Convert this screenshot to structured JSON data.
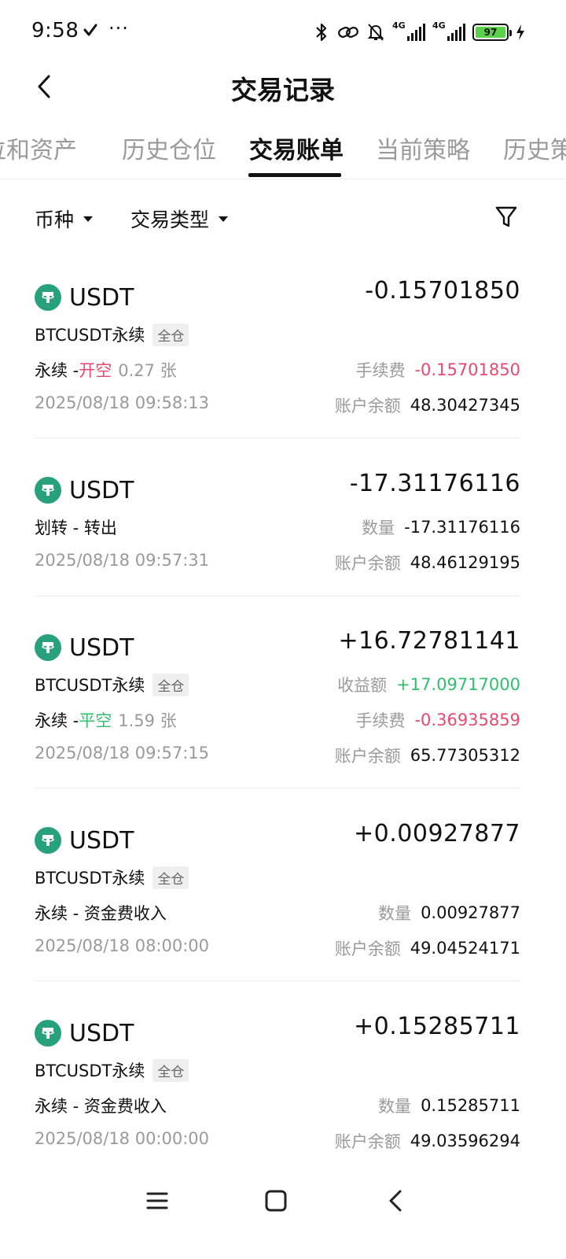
{
  "status_bar": {
    "time": "9:58",
    "dots": "···",
    "signal1_label": "4G",
    "signal2_label": "4G",
    "battery": "97"
  },
  "header": {
    "title": "交易记录"
  },
  "tabs": [
    {
      "label": "仓位和资产"
    },
    {
      "label": "历史仓位"
    },
    {
      "label": "交易账单"
    },
    {
      "label": "当前策略"
    },
    {
      "label": "历史策略"
    }
  ],
  "filters": {
    "coin": "币种",
    "type": "交易类型"
  },
  "colors": {
    "accent_green": "#2fbf6f",
    "negative_red": "#e8496f",
    "tether_green": "#26a17b",
    "battery_green": "#5ad14b"
  },
  "records": [
    {
      "coin": "USDT",
      "amount": "-0.15701850",
      "contract": "BTCUSDT永续",
      "margin": "全仓",
      "type_prefix": "永续 - ",
      "action": "开空",
      "size": "0.27 张",
      "fee_label": "手续费",
      "fee": "-0.15701850",
      "date": "2025/08/18 09:58:13",
      "balance_label": "账户余额",
      "balance": "48.30427345"
    },
    {
      "coin": "USDT",
      "amount": "-17.31176116",
      "type": "划转 - 转出",
      "qty_label": "数量",
      "qty": "-17.31176116",
      "date": "2025/08/18 09:57:31",
      "balance_label": "账户余额",
      "balance": "48.46129195"
    },
    {
      "coin": "USDT",
      "amount": "+16.72781141",
      "contract": "BTCUSDT永续",
      "margin": "全仓",
      "pnl_label": "收益额",
      "pnl": "+17.09717000",
      "type_prefix": "永续 - ",
      "action": "平空",
      "size": "1.59 张",
      "fee_label": "手续费",
      "fee": "-0.36935859",
      "date": "2025/08/18 09:57:15",
      "balance_label": "账户余额",
      "balance": "65.77305312"
    },
    {
      "coin": "USDT",
      "amount": "+0.00927877",
      "contract": "BTCUSDT永续",
      "margin": "全仓",
      "type": "永续 - 资金费收入",
      "qty_label": "数量",
      "qty": "0.00927877",
      "date": "2025/08/18 08:00:00",
      "balance_label": "账户余额",
      "balance": "49.04524171"
    },
    {
      "coin": "USDT",
      "amount": "+0.15285711",
      "contract": "BTCUSDT永续",
      "margin": "全仓",
      "type": "永续 - 资金费收入",
      "qty_label": "数量",
      "qty": "0.15285711",
      "date": "2025/08/18 00:00:00",
      "balance_label": "账户余额",
      "balance": "49.03596294"
    }
  ]
}
